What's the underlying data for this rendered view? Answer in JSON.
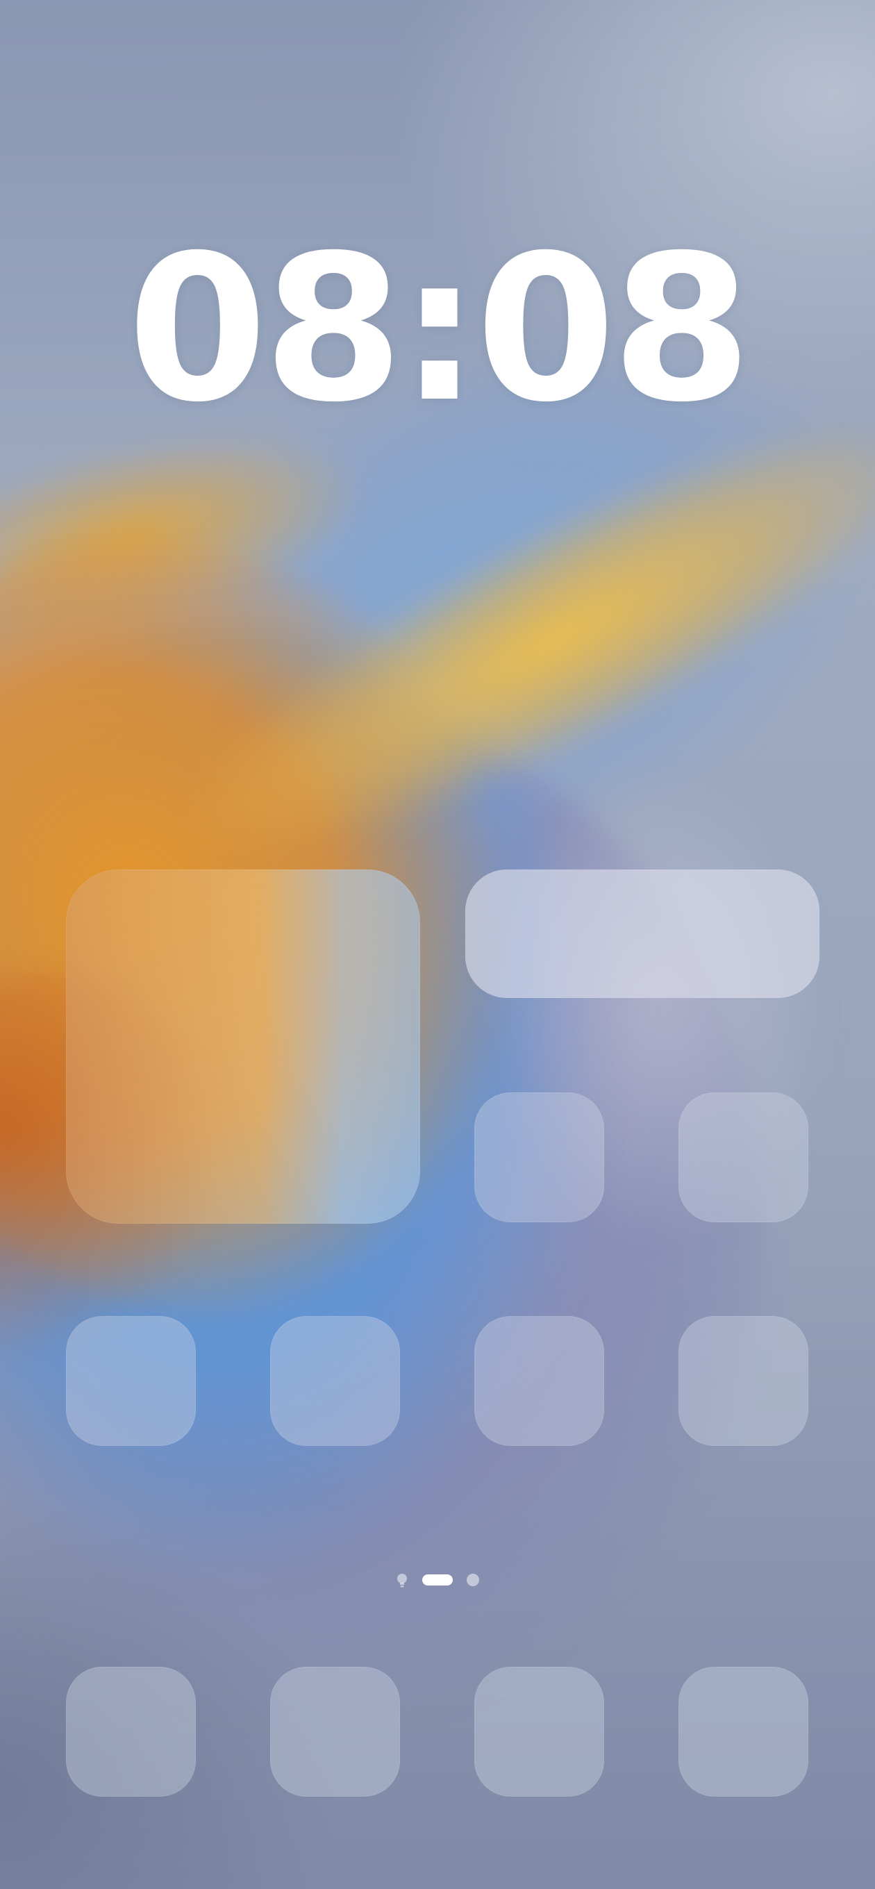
{
  "lockscreen": {
    "clock_time": "08:08"
  },
  "home_widgets": {
    "large_widget": "",
    "wide_widget": ""
  },
  "page_indicator": {
    "pages": 2,
    "current_page": 1,
    "icon": "lightbulb-icon"
  },
  "colors": {
    "clock_text": "#ffffff",
    "tile_glass": "rgba(210,216,232,0.38)",
    "accent_orange": "#e6962a",
    "accent_blue": "#5a96d7"
  }
}
